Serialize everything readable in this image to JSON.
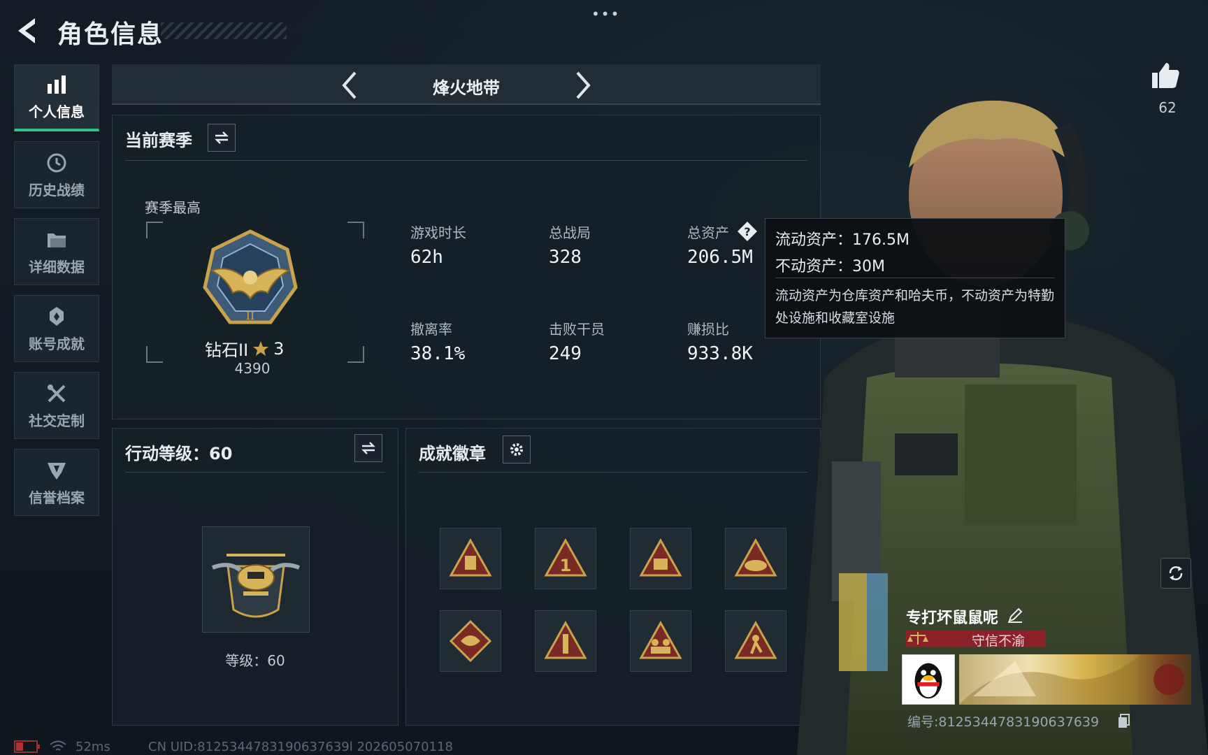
{
  "header": {
    "title": "角色信息",
    "menu_dots": "•••"
  },
  "sidebar": {
    "items": [
      {
        "label": "个人信息",
        "icon": "bar-chart-icon",
        "active": true
      },
      {
        "label": "历史战绩",
        "icon": "history-clock-icon",
        "active": false
      },
      {
        "label": "详细数据",
        "icon": "folder-icon",
        "active": false
      },
      {
        "label": "账号成就",
        "icon": "achievement-badge-icon",
        "active": false
      },
      {
        "label": "社交定制",
        "icon": "tools-icon",
        "active": false
      },
      {
        "label": "信誉档案",
        "icon": "shield-icon",
        "active": false
      }
    ]
  },
  "mode": {
    "title": "烽火地带"
  },
  "season": {
    "title": "当前赛季",
    "best_label": "赛季最高",
    "rank_name": "钻石II",
    "rank_stars": "3",
    "rank_points": "4390",
    "stats": [
      {
        "label": "游戏时长",
        "value": "62h"
      },
      {
        "label": "总战局",
        "value": "328"
      },
      {
        "label": "总资产",
        "value": "206.5M"
      },
      {
        "label": "撤离率",
        "value": "38.1%"
      },
      {
        "label": "击败干员",
        "value": "249"
      },
      {
        "label": "赚损比",
        "value": "933.8K"
      }
    ]
  },
  "tooltip": {
    "liquid": "流动资产：176.5M",
    "fixed": "不动资产：30M",
    "desc": "流动资产为仓库资产和哈夫币，不动资产为特勤处设施和收藏室设施"
  },
  "action_level": {
    "title": "行动等级：60",
    "level_text": "等级：60"
  },
  "badges": {
    "title": "成就徽章",
    "items": [
      "triangle-badge-icon",
      "triangle-1-badge-icon",
      "triangle-58-badge-icon",
      "triangle-nest-badge-icon",
      "dragon-diamond-badge-icon",
      "triangle-rocket-badge-icon",
      "triangle-soldiers-badge-icon",
      "triangle-runner-badge-icon"
    ]
  },
  "profile": {
    "likes": "62",
    "name": "专打坏鼠鼠呢",
    "honor_title": "守信不渝",
    "id_text": "编号:8125344783190637639"
  },
  "status": {
    "ping": "52ms",
    "uid": "CN UID:8125344783190637639l 202605070118"
  },
  "colors": {
    "accent": "#34c28a",
    "honor": "#8a2229",
    "gold": "#c9a24a"
  }
}
